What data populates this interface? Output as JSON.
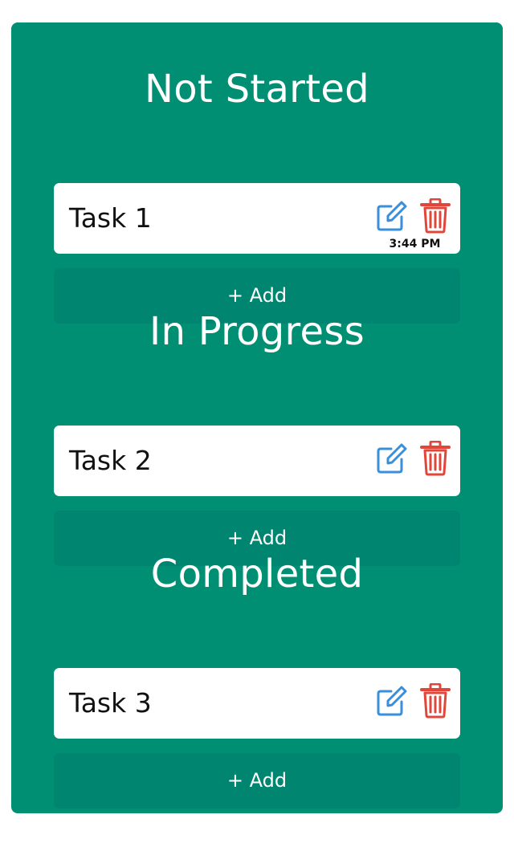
{
  "columns": [
    {
      "title": "Not Started",
      "task": {
        "name": "Task 1",
        "time": "3:44 PM"
      },
      "add_label": "+ Add"
    },
    {
      "title": "In Progress",
      "task": {
        "name": "Task 2",
        "time": ""
      },
      "add_label": "+ Add"
    },
    {
      "title": "Completed",
      "task": {
        "name": "Task 3",
        "time": ""
      },
      "add_label": "+ Add"
    }
  ],
  "icons": {
    "edit": "edit-icon",
    "delete": "trash-icon"
  },
  "colors": {
    "board_background": "#008f73",
    "add_button": "#008570",
    "edit_icon": "#3a8fd8",
    "delete_icon": "#e0473a"
  }
}
